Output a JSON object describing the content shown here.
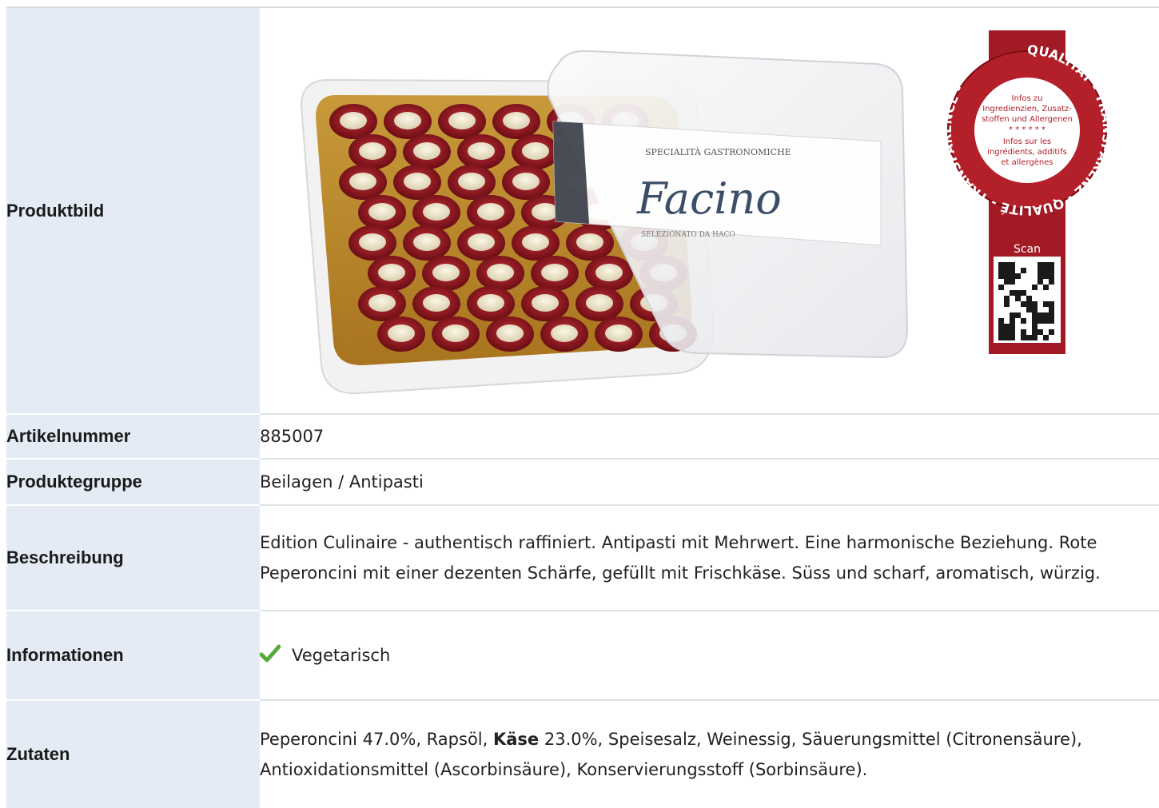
{
  "rows": {
    "image": {
      "label": "Produktbild"
    },
    "article": {
      "label": "Artikelnummer",
      "value": "885007"
    },
    "group": {
      "label": "Produktegruppe",
      "value": "Beilagen / Antipasti"
    },
    "description": {
      "label": "Beschreibung",
      "value": "Edition Culinaire - authentisch raffiniert. Antipasti mit Mehrwert. Eine harmonische Beziehung. Rote Peperoncini mit einer dezenten Schärfe, gefüllt mit Frischkäse. Süss und scharf, aromatisch, würzig."
    },
    "info": {
      "label": "Informationen",
      "badge": "Vegetarisch",
      "badge_icon": "checkmark-icon"
    },
    "ingredients": {
      "label": "Zutaten",
      "part1": "Peperoncini 47.0%, Rapsöl, ",
      "bold": "Käse",
      "part2": " 23.0%, Speisesalz, Weinessig, Säuerungsmittel (Citronensäure), Antioxidationsmittel (Ascorbinsäure), Konservierungsstoff (Sorbinsäure)."
    }
  },
  "product_image": {
    "brand_top": "SPECIALITÀ GASTRONOMICHE",
    "brand_name": "Facino",
    "brand_sub": "SELEZIONATO DA HACO"
  },
  "seal": {
    "ring_text": "QUALITÄT - TRANSPARENZ - QUALITÉ - TRANSPARENCE -",
    "info_de_1": "Infos zu",
    "info_de_2": "Ingredienzien, Zusatz-",
    "info_de_3": "stoffen und Allergenen",
    "stars": "* * * * * *",
    "info_fr_1": "Infos sur les",
    "info_fr_2": "ingrédients, additifs",
    "info_fr_3": "et allergènes",
    "scan": "Scan"
  },
  "colors": {
    "label_bg": "#e5ebf5",
    "seal_red": "#b3202a",
    "check_green": "#5aa83a"
  }
}
